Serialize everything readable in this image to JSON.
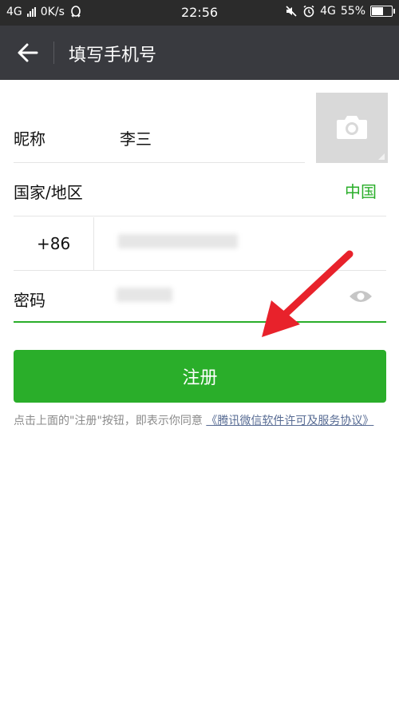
{
  "status_bar": {
    "network": "4G",
    "speed": "0K/s",
    "time": "22:56",
    "network_right": "4G",
    "battery": "55%",
    "battery_level": 0.55
  },
  "header": {
    "title": "填写手机号"
  },
  "form": {
    "nickname": {
      "label": "昵称",
      "value": "李三"
    },
    "region": {
      "label": "国家/地区",
      "value": "中国"
    },
    "phone": {
      "code": "+86"
    },
    "password": {
      "label": "密码"
    }
  },
  "register_button": {
    "label": "注册"
  },
  "agreement": {
    "text": "点击上面的\"注册\"按钮，即表示你同意",
    "link": "《腾讯微信软件许可及服务协议》"
  },
  "colors": {
    "accent": "#2aae2a",
    "header_bg": "#393a3f",
    "statusbar_bg": "#2b2b2b",
    "annotation_arrow": "#e8222b"
  },
  "icons": {
    "back": "arrow-left-icon",
    "photo": "camera-icon",
    "password_toggle": "eye-icon"
  }
}
